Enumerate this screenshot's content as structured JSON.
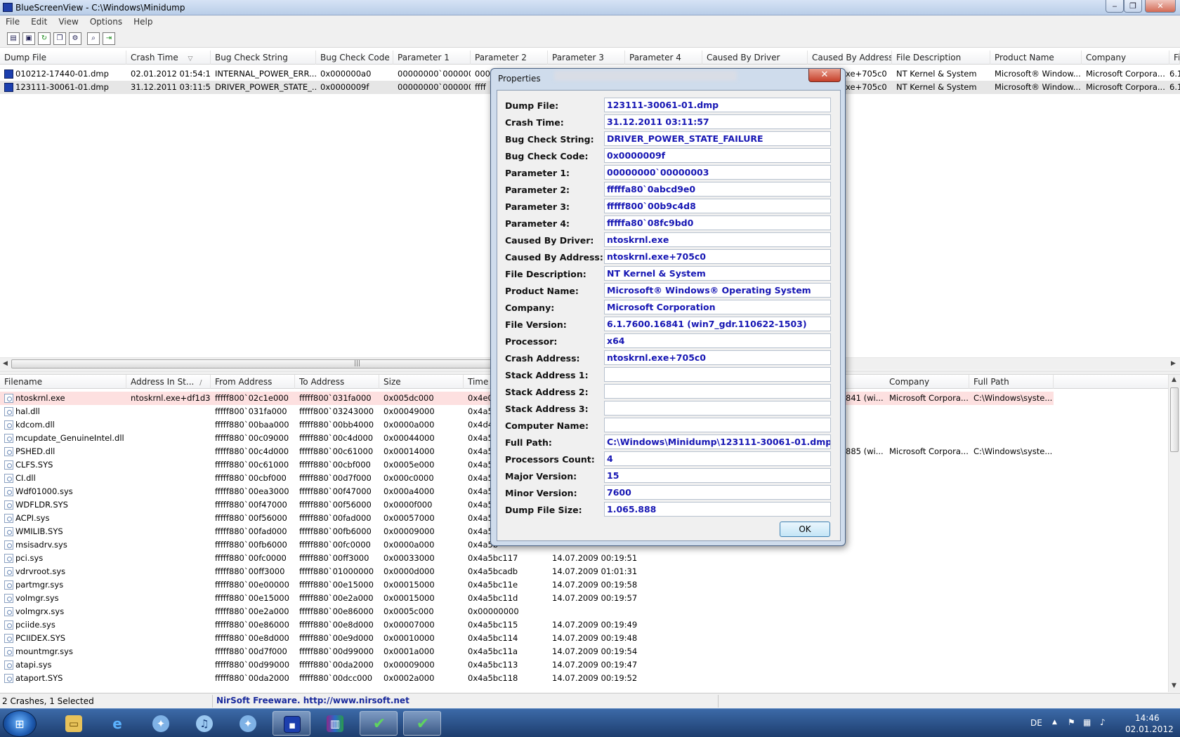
{
  "window": {
    "title": "BlueScreenView  -  C:\\Windows\\Minidump",
    "minimize": "‒",
    "restore": "❐",
    "close": "✕"
  },
  "menu": [
    "File",
    "Edit",
    "View",
    "Options",
    "Help"
  ],
  "toolbar": [
    "properties-icon",
    "save-icon",
    "refresh-icon",
    "copy-icon",
    "options-icon",
    "find-icon",
    "exit-icon"
  ],
  "upper": {
    "columns": [
      "Dump File",
      "Crash Time",
      "Bug Check String",
      "Bug Check Code",
      "Parameter 1",
      "Parameter 2",
      "Parameter 3",
      "Parameter 4",
      "Caused By Driver",
      "Caused By Address",
      "File Description",
      "Product Name",
      "Company",
      "Fil"
    ],
    "sort_indicator": "▽",
    "rows": [
      {
        "dump": "010212-17440-01.dmp",
        "time": "02.01.2012 01:54:10",
        "bcs": "INTERNAL_POWER_ERR...",
        "bcc": "0x000000a0",
        "p1": "00000000`000000...",
        "p2": "0000",
        "addr": "xe+705c0",
        "desc": "NT Kernel & System",
        "product": "Microsoft® Window...",
        "company": "Microsoft Corpora...",
        "fil": "6.1"
      },
      {
        "dump": "123111-30061-01.dmp",
        "time": "31.12.2011 03:11:57",
        "bcs": "DRIVER_POWER_STATE_...",
        "bcc": "0x0000009f",
        "p1": "00000000`000000...",
        "p2": "ffff",
        "addr": "xe+705c0",
        "desc": "NT Kernel & System",
        "product": "Microsoft® Window...",
        "company": "Microsoft Corpora...",
        "fil": "6.1"
      }
    ]
  },
  "lower": {
    "columns": [
      "Filename",
      "Address In St...",
      "From Address",
      "To Address",
      "Size",
      "Time S",
      "Company",
      "Full Path"
    ],
    "sort_indicator": "/",
    "rows": [
      {
        "file": "ntoskrnl.exe",
        "addr_in": "ntoskrnl.exe+df1d3",
        "from": "fffff800`02c1e000",
        "to": "fffff800`031fa000",
        "size": "0x005dc000",
        "ts": "0x4e02",
        "date": "",
        "extra": "841 (wi...",
        "company": "Microsoft Corpora...",
        "path": "C:\\Windows\\syste..."
      },
      {
        "file": "hal.dll",
        "addr_in": "",
        "from": "fffff800`031fa000",
        "to": "fffff800`03243000",
        "size": "0x00049000",
        "ts": "0x4a5b",
        "date": "",
        "extra": "",
        "company": "",
        "path": ""
      },
      {
        "file": "kdcom.dll",
        "addr_in": "",
        "from": "fffff880`00baa000",
        "to": "fffff880`00bb4000",
        "size": "0x0000a000",
        "ts": "0x4d4d",
        "date": "",
        "extra": "",
        "company": "",
        "path": ""
      },
      {
        "file": "mcupdate_GenuineIntel.dll",
        "addr_in": "",
        "from": "fffff880`00c09000",
        "to": "fffff880`00c4d000",
        "size": "0x00044000",
        "ts": "0x4a5b",
        "date": "",
        "extra": "",
        "company": "",
        "path": ""
      },
      {
        "file": "PSHED.dll",
        "addr_in": "",
        "from": "fffff880`00c4d000",
        "to": "fffff880`00c61000",
        "size": "0x00014000",
        "ts": "0x4a5b",
        "date": "",
        "extra": "885 (wi...",
        "company": "Microsoft Corpora...",
        "path": "C:\\Windows\\syste..."
      },
      {
        "file": "CLFS.SYS",
        "addr_in": "",
        "from": "fffff880`00c61000",
        "to": "fffff880`00cbf000",
        "size": "0x0005e000",
        "ts": "0x4a5b",
        "date": "",
        "extra": "",
        "company": "",
        "path": ""
      },
      {
        "file": "CI.dll",
        "addr_in": "",
        "from": "fffff880`00cbf000",
        "to": "fffff880`00d7f000",
        "size": "0x000c0000",
        "ts": "0x4a5b",
        "date": "",
        "extra": "",
        "company": "",
        "path": ""
      },
      {
        "file": "Wdf01000.sys",
        "addr_in": "",
        "from": "fffff880`00ea3000",
        "to": "fffff880`00f47000",
        "size": "0x000a4000",
        "ts": "0x4a5b",
        "date": "",
        "extra": "",
        "company": "",
        "path": ""
      },
      {
        "file": "WDFLDR.SYS",
        "addr_in": "",
        "from": "fffff880`00f47000",
        "to": "fffff880`00f56000",
        "size": "0x0000f000",
        "ts": "0x4a5b",
        "date": "",
        "extra": "",
        "company": "",
        "path": ""
      },
      {
        "file": "ACPI.sys",
        "addr_in": "",
        "from": "fffff880`00f56000",
        "to": "fffff880`00fad000",
        "size": "0x00057000",
        "ts": "0x4a5b",
        "date": "",
        "extra": "",
        "company": "",
        "path": ""
      },
      {
        "file": "WMILIB.SYS",
        "addr_in": "",
        "from": "fffff880`00fad000",
        "to": "fffff880`00fb6000",
        "size": "0x00009000",
        "ts": "0x4a5b",
        "date": "",
        "extra": "",
        "company": "",
        "path": ""
      },
      {
        "file": "msisadrv.sys",
        "addr_in": "",
        "from": "fffff880`00fb6000",
        "to": "fffff880`00fc0000",
        "size": "0x0000a000",
        "ts": "0x4a5b",
        "date": "",
        "extra": "",
        "company": "",
        "path": ""
      },
      {
        "file": "pci.sys",
        "addr_in": "",
        "from": "fffff880`00fc0000",
        "to": "fffff880`00ff3000",
        "size": "0x00033000",
        "ts": "0x4a5bc117",
        "date": "14.07.2009 00:19:51",
        "extra": "",
        "company": "",
        "path": ""
      },
      {
        "file": "vdrvroot.sys",
        "addr_in": "",
        "from": "fffff880`00ff3000",
        "to": "fffff880`01000000",
        "size": "0x0000d000",
        "ts": "0x4a5bcadb",
        "date": "14.07.2009 01:01:31",
        "extra": "",
        "company": "",
        "path": ""
      },
      {
        "file": "partmgr.sys",
        "addr_in": "",
        "from": "fffff880`00e00000",
        "to": "fffff880`00e15000",
        "size": "0x00015000",
        "ts": "0x4a5bc11e",
        "date": "14.07.2009 00:19:58",
        "extra": "",
        "company": "",
        "path": ""
      },
      {
        "file": "volmgr.sys",
        "addr_in": "",
        "from": "fffff880`00e15000",
        "to": "fffff880`00e2a000",
        "size": "0x00015000",
        "ts": "0x4a5bc11d",
        "date": "14.07.2009 00:19:57",
        "extra": "",
        "company": "",
        "path": ""
      },
      {
        "file": "volmgrx.sys",
        "addr_in": "",
        "from": "fffff880`00e2a000",
        "to": "fffff880`00e86000",
        "size": "0x0005c000",
        "ts": "0x00000000",
        "date": "",
        "extra": "",
        "company": "",
        "path": ""
      },
      {
        "file": "pciide.sys",
        "addr_in": "",
        "from": "fffff880`00e86000",
        "to": "fffff880`00e8d000",
        "size": "0x00007000",
        "ts": "0x4a5bc115",
        "date": "14.07.2009 00:19:49",
        "extra": "",
        "company": "",
        "path": ""
      },
      {
        "file": "PCIIDEX.SYS",
        "addr_in": "",
        "from": "fffff880`00e8d000",
        "to": "fffff880`00e9d000",
        "size": "0x00010000",
        "ts": "0x4a5bc114",
        "date": "14.07.2009 00:19:48",
        "extra": "",
        "company": "",
        "path": ""
      },
      {
        "file": "mountmgr.sys",
        "addr_in": "",
        "from": "fffff880`00d7f000",
        "to": "fffff880`00d99000",
        "size": "0x0001a000",
        "ts": "0x4a5bc11a",
        "date": "14.07.2009 00:19:54",
        "extra": "",
        "company": "",
        "path": ""
      },
      {
        "file": "atapi.sys",
        "addr_in": "",
        "from": "fffff880`00d99000",
        "to": "fffff880`00da2000",
        "size": "0x00009000",
        "ts": "0x4a5bc113",
        "date": "14.07.2009 00:19:47",
        "extra": "",
        "company": "",
        "path": ""
      },
      {
        "file": "ataport.SYS",
        "addr_in": "",
        "from": "fffff880`00da2000",
        "to": "fffff880`00dcc000",
        "size": "0x0002a000",
        "ts": "0x4a5bc118",
        "date": "14.07.2009 00:19:52",
        "extra": "",
        "company": "",
        "path": ""
      }
    ]
  },
  "status": {
    "count": "2 Crashes, 1 Selected",
    "link": "NirSoft Freeware.  http://www.nirsoft.net"
  },
  "dialog": {
    "title": "Properties",
    "close": "✕",
    "ok": "OK",
    "fields": [
      {
        "label": "Dump File:",
        "value": "123111-30061-01.dmp"
      },
      {
        "label": "Crash Time:",
        "value": "31.12.2011 03:11:57"
      },
      {
        "label": "Bug Check String:",
        "value": "DRIVER_POWER_STATE_FAILURE"
      },
      {
        "label": "Bug Check Code:",
        "value": "0x0000009f"
      },
      {
        "label": "Parameter 1:",
        "value": "00000000`00000003"
      },
      {
        "label": "Parameter 2:",
        "value": "fffffa80`0abcd9e0"
      },
      {
        "label": "Parameter 3:",
        "value": "fffff800`00b9c4d8"
      },
      {
        "label": "Parameter 4:",
        "value": "fffffa80`08fc9bd0"
      },
      {
        "label": "Caused By Driver:",
        "value": "ntoskrnl.exe"
      },
      {
        "label": "Caused By Address:",
        "value": "ntoskrnl.exe+705c0"
      },
      {
        "label": "File Description:",
        "value": "NT Kernel & System"
      },
      {
        "label": "Product Name:",
        "value": "Microsoft® Windows® Operating System"
      },
      {
        "label": "Company:",
        "value": "Microsoft Corporation"
      },
      {
        "label": "File Version:",
        "value": "6.1.7600.16841 (win7_gdr.110622-1503)"
      },
      {
        "label": "Processor:",
        "value": "x64"
      },
      {
        "label": "Crash Address:",
        "value": "ntoskrnl.exe+705c0"
      },
      {
        "label": "Stack Address 1:",
        "value": ""
      },
      {
        "label": "Stack Address 2:",
        "value": ""
      },
      {
        "label": "Stack Address 3:",
        "value": ""
      },
      {
        "label": "Computer Name:",
        "value": ""
      },
      {
        "label": "Full Path:",
        "value": "C:\\Windows\\Minidump\\123111-30061-01.dmp"
      },
      {
        "label": "Processors Count:",
        "value": "4"
      },
      {
        "label": "Major Version:",
        "value": "15"
      },
      {
        "label": "Minor Version:",
        "value": "7600"
      },
      {
        "label": "Dump File Size:",
        "value": "1.065.888"
      }
    ]
  },
  "taskbar": {
    "apps": [
      "explorer-icon",
      "internet-explorer-icon",
      "safari-icon",
      "itunes-icon",
      "safari-icon",
      "bluescreenview-icon",
      "winrar-icon",
      "checkmark-app-icon",
      "checkmark-app-icon"
    ],
    "language": "DE",
    "time": "14:46",
    "date": "02.01.2012"
  },
  "colors": {
    "value_text": "#1717b4",
    "highlight_row": "#fde0e0",
    "status_link": "#1a2a9c"
  }
}
